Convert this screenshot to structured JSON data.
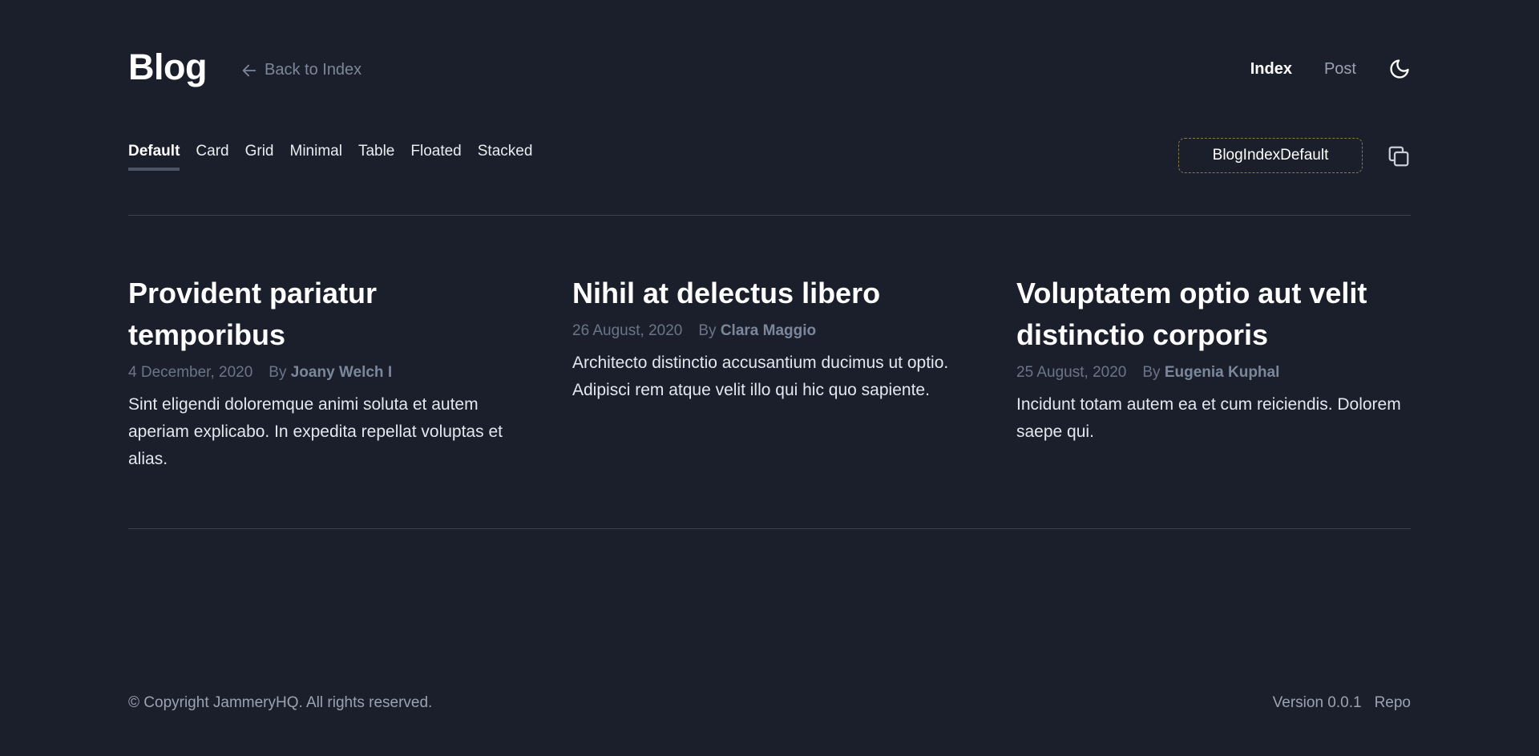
{
  "header": {
    "logo": "Blog",
    "back_link": "Back to Index",
    "nav": [
      {
        "label": "Index",
        "active": true
      },
      {
        "label": "Post",
        "active": false
      }
    ],
    "theme_icon": "moon-icon"
  },
  "tabs": [
    {
      "label": "Default",
      "active": true
    },
    {
      "label": "Card",
      "active": false
    },
    {
      "label": "Grid",
      "active": false
    },
    {
      "label": "Minimal",
      "active": false
    },
    {
      "label": "Table",
      "active": false
    },
    {
      "label": "Floated",
      "active": false
    },
    {
      "label": "Stacked",
      "active": false
    }
  ],
  "component_name": "BlogIndexDefault",
  "copy_icon": "copy-icon",
  "posts": [
    {
      "title": "Provident pariatur temporibus",
      "date": "4 December, 2020",
      "by": "By",
      "author": "Joany Welch I",
      "excerpt": "Sint eligendi doloremque animi soluta et autem aperiam explicabo. In expedita repellat voluptas et alias."
    },
    {
      "title": "Nihil at delectus libero",
      "date": "26 August, 2020",
      "by": "By",
      "author": "Clara Maggio",
      "excerpt": "Architecto distinctio accusantium ducimus ut optio. Adipisci rem atque velit illo qui hic quo sapiente."
    },
    {
      "title": "Voluptatem optio aut velit distinctio corporis",
      "date": "25 August, 2020",
      "by": "By",
      "author": "Eugenia Kuphal",
      "excerpt": "Incidunt totam autem ea et cum reiciendis. Dolorem saepe qui."
    }
  ],
  "footer": {
    "copyright": "© Copyright JammeryHQ. All rights reserved.",
    "version": "Version 0.0.1",
    "repo": "Repo"
  },
  "colors": {
    "background": "#1b1f2b",
    "muted_text": "#7c8799",
    "divider": "#3a4050",
    "dashed_border": "#8a7b46"
  }
}
